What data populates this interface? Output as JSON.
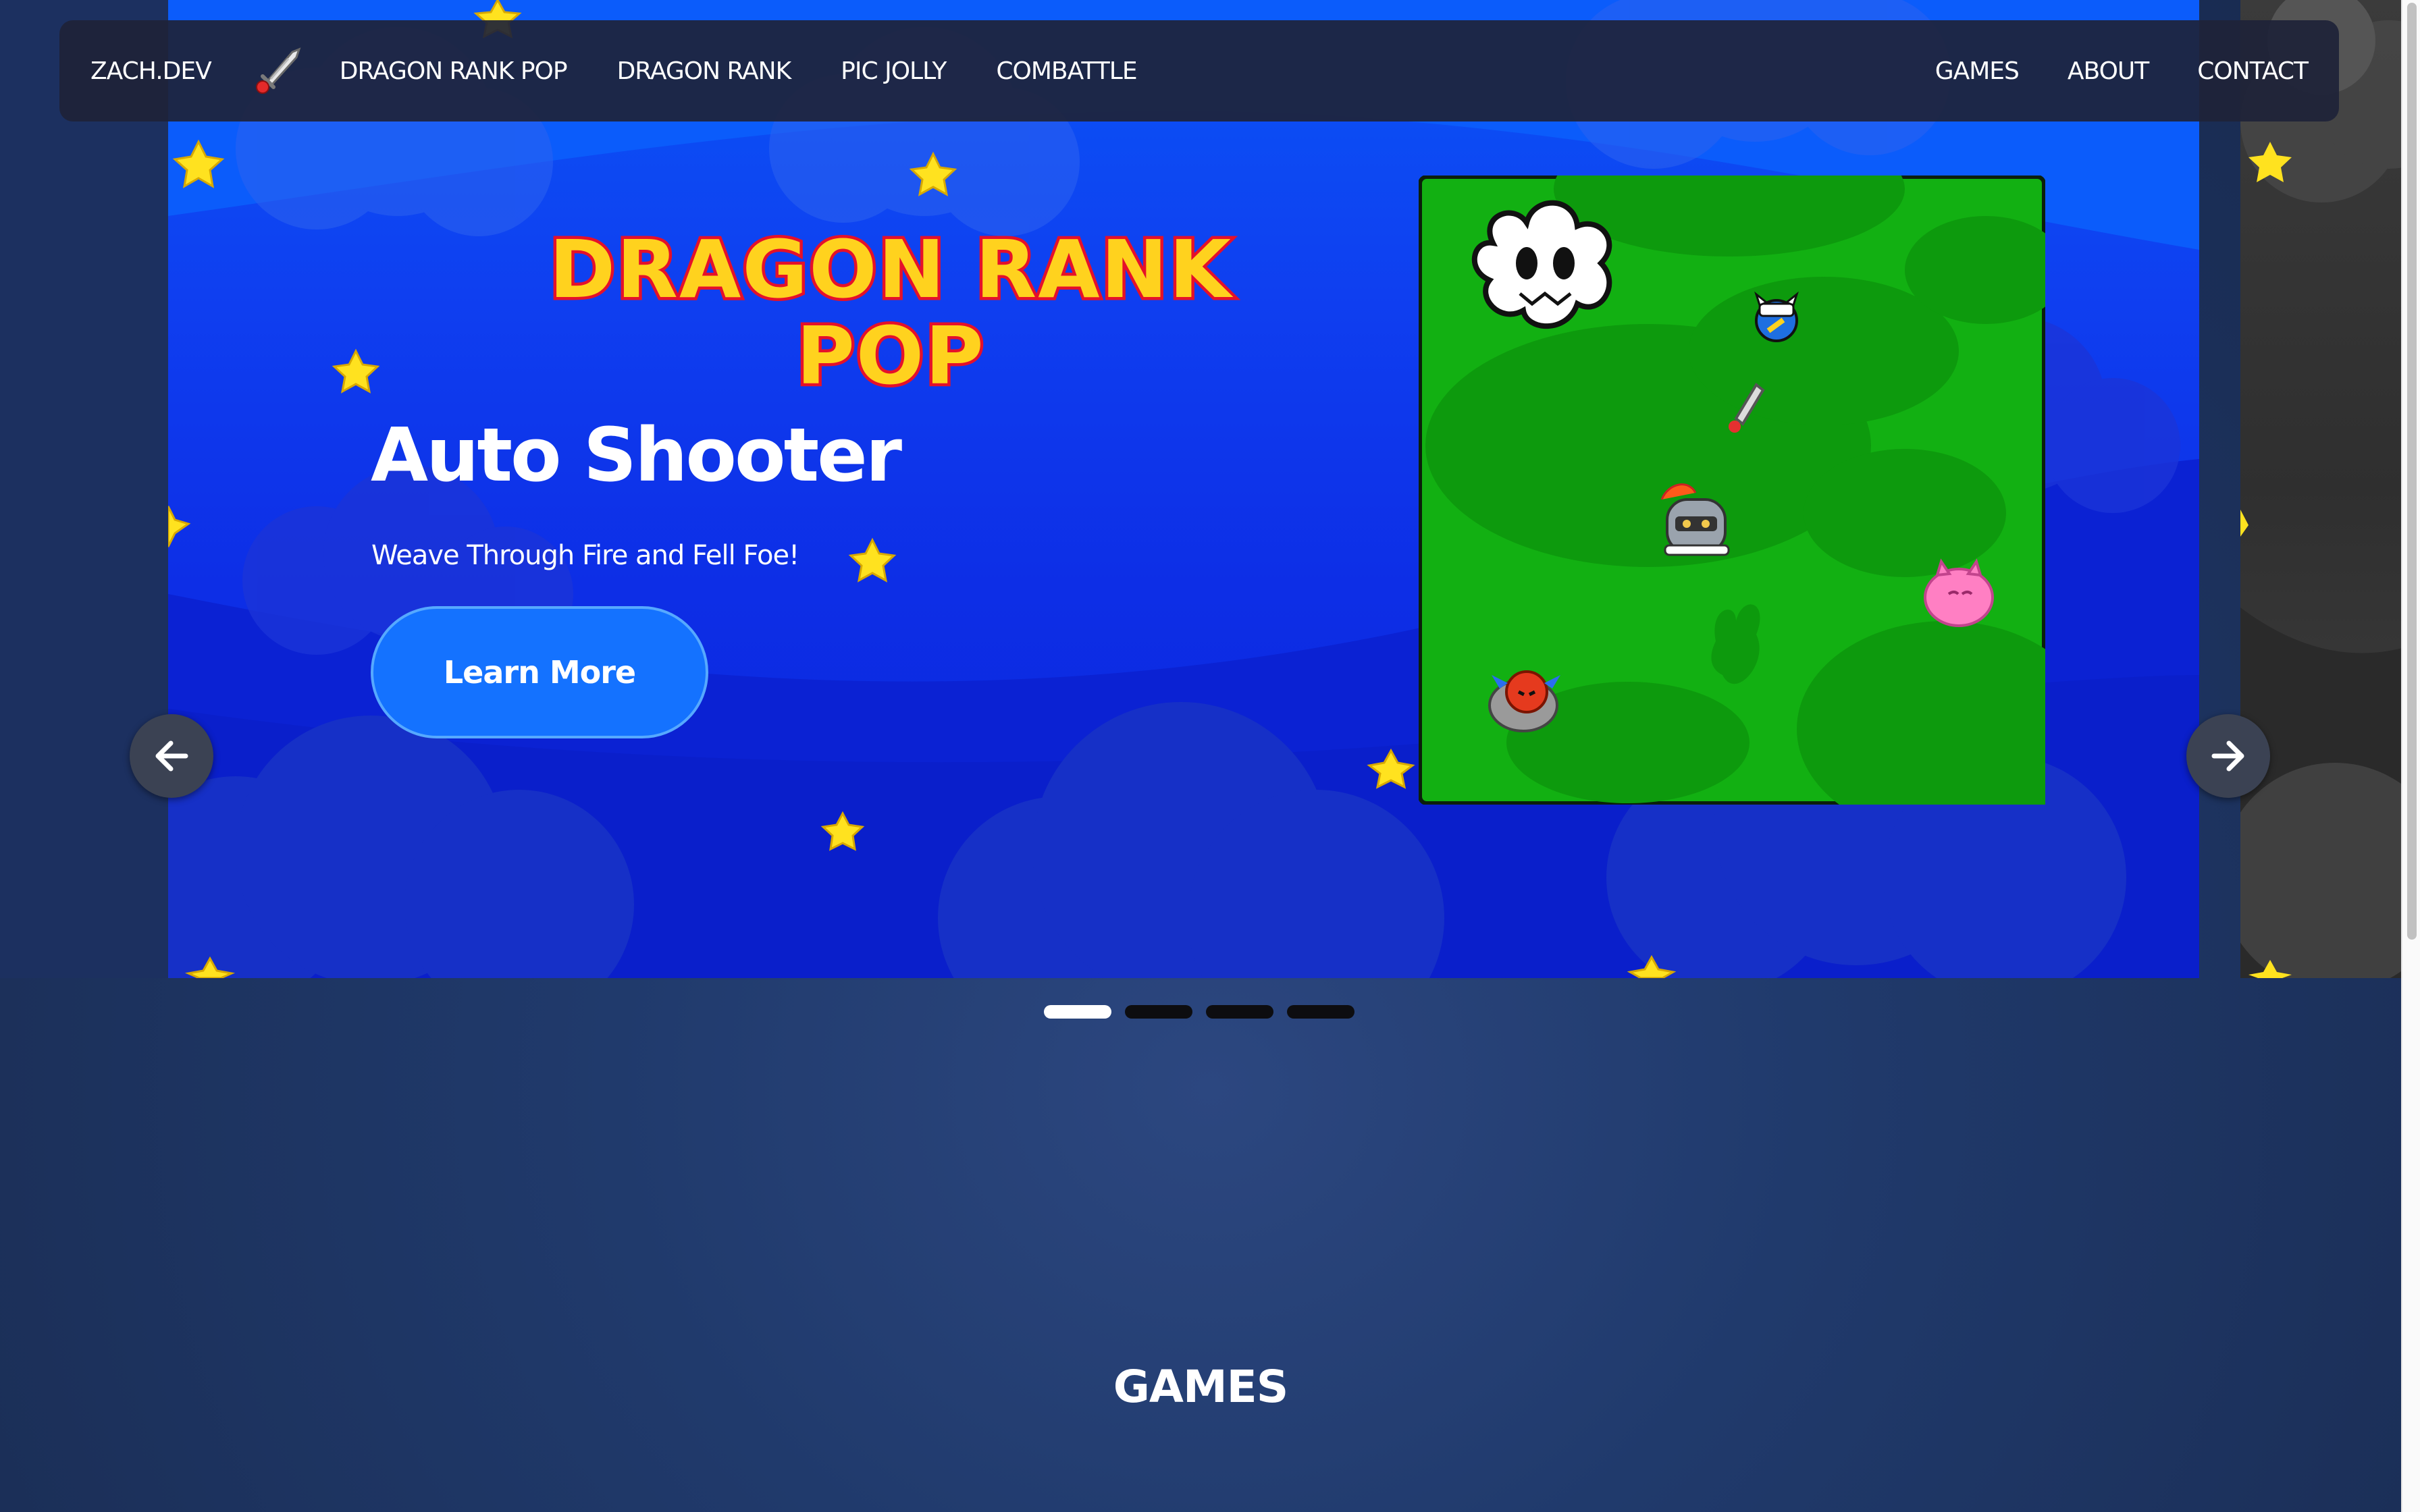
{
  "navbar": {
    "brand": "ZACH.DEV",
    "brand_icon": "sword-icon",
    "left_links": [
      "DRAGON RANK POP",
      "DRAGON RANK",
      "PIC JOLLY",
      "COMBATTLE"
    ],
    "right_links": [
      "GAMES",
      "ABOUT",
      "CONTACT"
    ]
  },
  "carousel": {
    "slide": {
      "logo_line_1": "DRAGON RANK",
      "logo_line_2": "POP",
      "subtitle": "Auto Shooter",
      "tagline": "Weave Through Fire and Fell Foe!",
      "button_label": "Learn More"
    },
    "prev_icon": "arrow-left-icon",
    "next_icon": "arrow-right-icon",
    "slide_count": 4,
    "active_index": 0
  },
  "games_section": {
    "heading": "GAMES"
  },
  "colors": {
    "page_bg": "#1b2f58",
    "slide_bg": "#0f3ff0",
    "nav_bg": "#1e2338",
    "button": "#1472ff",
    "logo_fill": "#ffd21e",
    "logo_stroke": "#e5102a",
    "game_grass": "#12b012"
  }
}
